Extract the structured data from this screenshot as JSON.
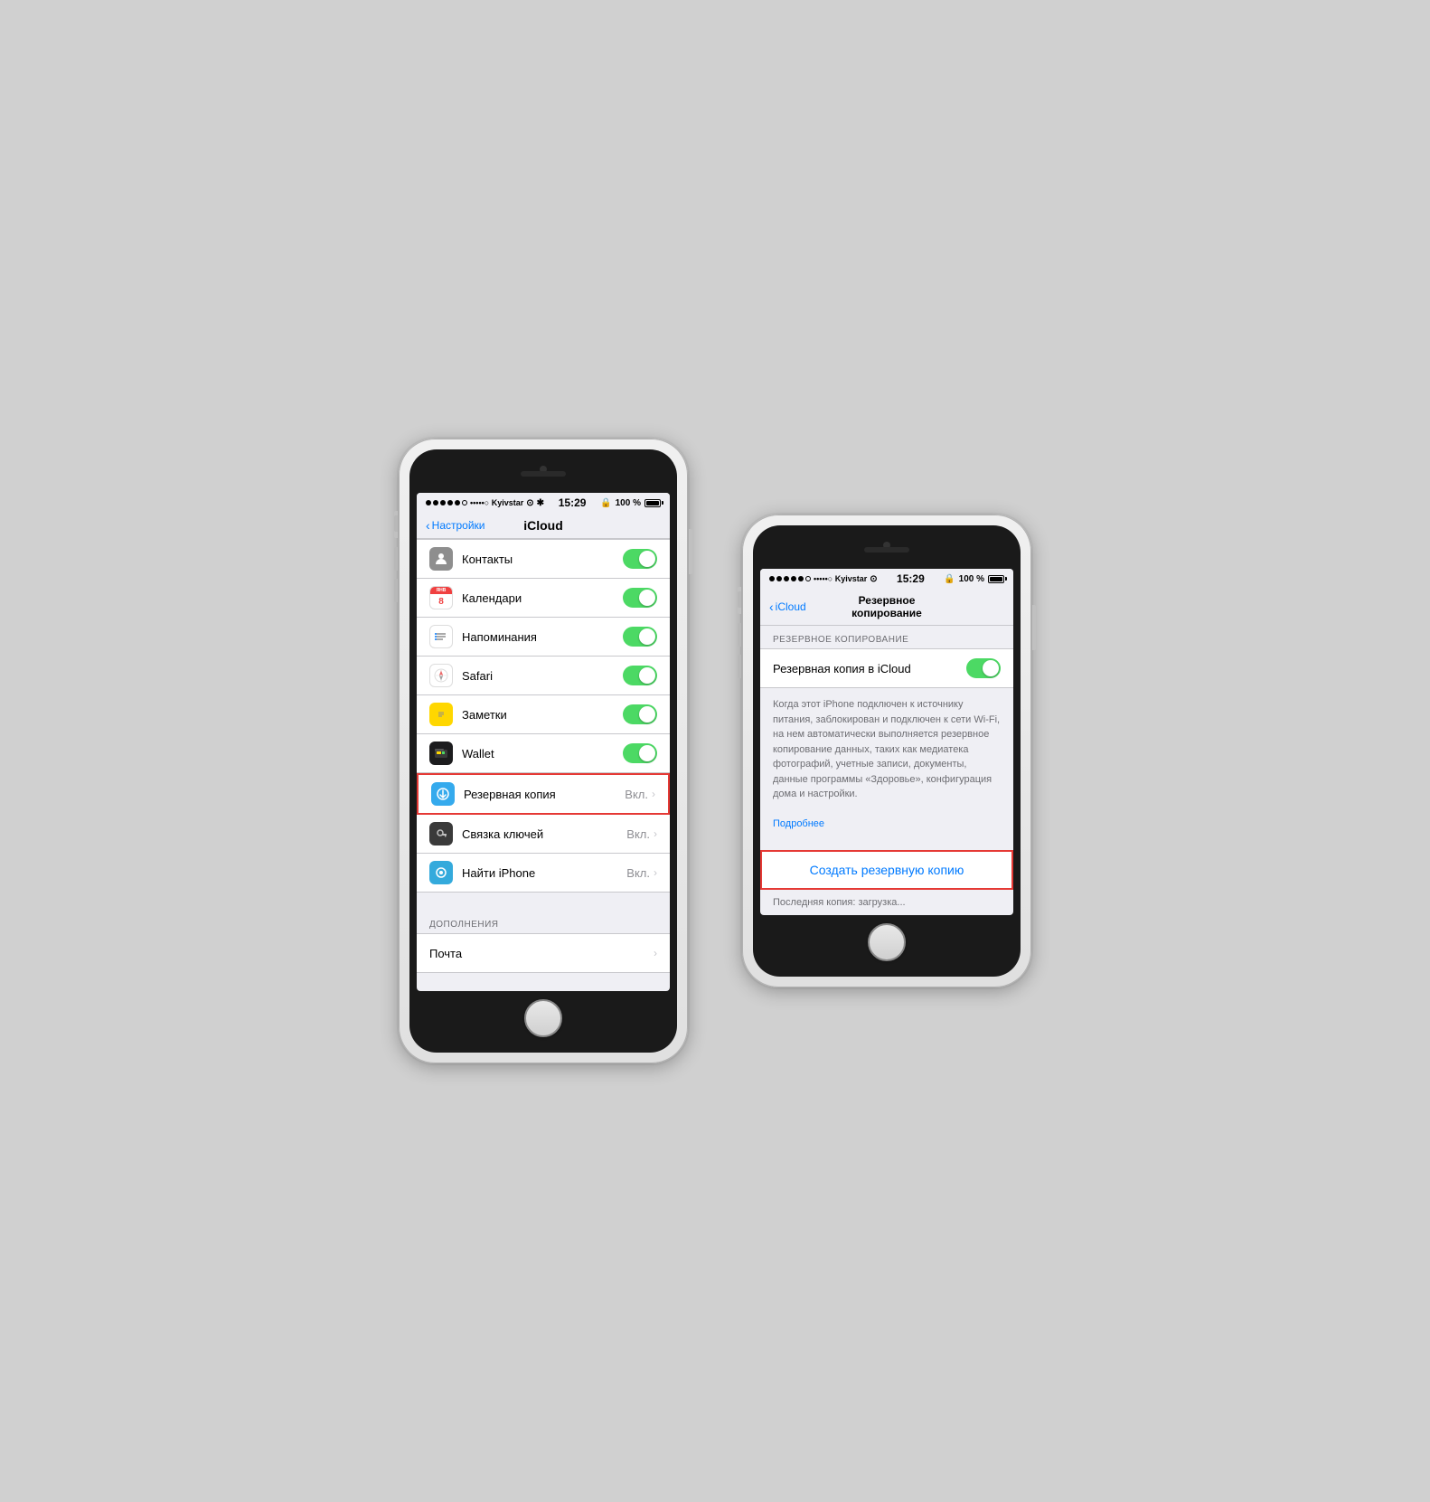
{
  "phone1": {
    "status": {
      "carrier": "•••••○ Kyivstar",
      "wifi": "▼",
      "time": "15:29",
      "battery_pct": "100 %"
    },
    "nav": {
      "back_label": "Настройки",
      "title": "iCloud"
    },
    "items": [
      {
        "id": "contacts",
        "label": "Контакты",
        "icon_type": "contacts",
        "toggle": true
      },
      {
        "id": "calendar",
        "label": "Календари",
        "icon_type": "calendar",
        "toggle": true
      },
      {
        "id": "reminders",
        "label": "Напоминания",
        "icon_type": "reminders",
        "toggle": true
      },
      {
        "id": "safari",
        "label": "Safari",
        "icon_type": "safari",
        "toggle": true
      },
      {
        "id": "notes",
        "label": "Заметки",
        "icon_type": "notes",
        "toggle": true
      },
      {
        "id": "wallet",
        "label": "Wallet",
        "icon_type": "wallet",
        "toggle": true
      },
      {
        "id": "backup",
        "label": "Резервная копия",
        "icon_type": "backup",
        "value": "Вкл.",
        "chevron": true,
        "highlighted": true
      },
      {
        "id": "keychain",
        "label": "Связка ключей",
        "icon_type": "keychain",
        "value": "Вкл.",
        "chevron": true
      },
      {
        "id": "findphone",
        "label": "Найти iPhone",
        "icon_type": "findphone",
        "value": "Вкл.",
        "chevron": true
      }
    ],
    "addons_header": "ДОПОЛНЕНИЯ",
    "addons": [
      {
        "id": "mail",
        "label": "Почта",
        "chevron": true
      }
    ]
  },
  "phone2": {
    "status": {
      "carrier": "•••••○ Kyivstar",
      "wifi": "▼",
      "time": "15:29",
      "battery_pct": "100 %"
    },
    "nav": {
      "back_label": "iCloud",
      "title": "Резервное копирование"
    },
    "section_header": "РЕЗЕРВНОЕ КОПИРОВАНИЕ",
    "toggle_label": "Резервная копия в iCloud",
    "description": "Когда этот iPhone подключен к источнику питания, заблокирован и подключен к сети Wi-Fi, на нем автоматически выполняется резервное копирование данных, таких как медиатека фотографий, учетные записи, документы, данные программы «Здоровье», конфигурация дома и настройки.",
    "link_label": "Подробнее",
    "create_backup_label": "Создать резервную копию",
    "last_backup": "Последняя копия: загрузка..."
  }
}
